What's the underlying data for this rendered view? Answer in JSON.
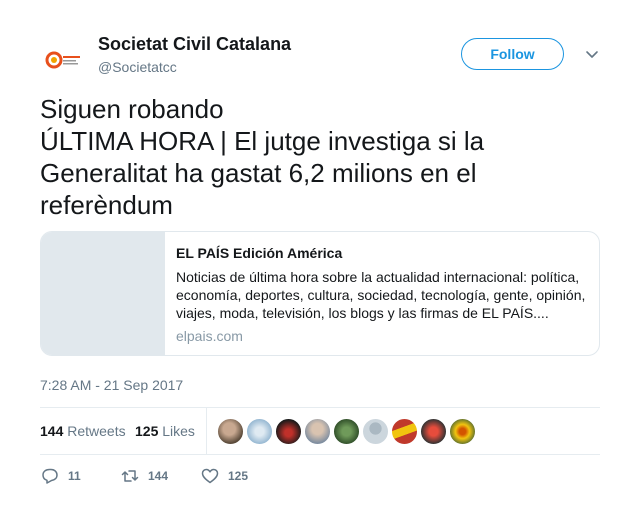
{
  "account": {
    "name": "Societat Civil Catalana",
    "handle": "@Societatcc",
    "avatar_icon": "societat-civil-catalana-logo",
    "follow_label": "Follow"
  },
  "tweet": {
    "text": "Siguen robando\nÚLTIMA HORA | El jutge investiga si la Generalitat ha gastat 6,2 milions en el referèndum",
    "timestamp": "7:28 AM - 21 Sep 2017"
  },
  "card": {
    "title": "EL PAÍS Edición América",
    "description": "Noticias de última hora sobre la actualidad internacional: política, economía, deportes, cultura, sociedad, tecnología, gente, opinión, viajes, moda, televisión, los blogs y las firmas de EL PAÍS....",
    "domain": "elpais.com"
  },
  "stats": {
    "retweets_count": "144",
    "retweets_label": "Retweets",
    "likes_count": "125",
    "likes_label": "Likes"
  },
  "actions": {
    "reply_count": "11",
    "retweet_count": "144",
    "like_count": "125"
  },
  "colors": {
    "accent": "#1b95e0",
    "secondary_text": "#657786",
    "border": "#e1e8ed"
  }
}
